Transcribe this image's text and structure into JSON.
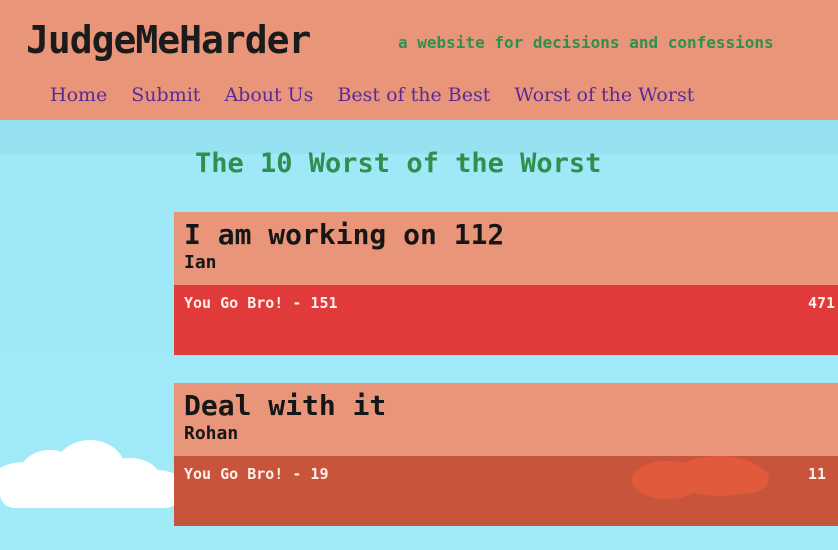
{
  "site": {
    "title": "JudgeMeHarder",
    "tagline": "a website for decisions and confessions"
  },
  "nav": {
    "items": [
      {
        "label": "Home"
      },
      {
        "label": "Submit"
      },
      {
        "label": "About Us"
      },
      {
        "label": "Best of the Best"
      },
      {
        "label": "Worst of the Worst"
      }
    ]
  },
  "main": {
    "page_title": "The 10 Worst of the Worst",
    "posts": [
      {
        "title": "I am working on 112",
        "author": "Ian",
        "vote_left": "You Go Bro! - 151",
        "vote_right": "471"
      },
      {
        "title": "Deal with it",
        "author": "Rohan",
        "vote_left": "You Go Bro! - 19",
        "vote_right": "11"
      }
    ]
  },
  "colors": {
    "header_bg": "#e8957a",
    "nav_link": "#5b2a9a",
    "accent_green": "#2f8f4e",
    "sky": "#a1eaf8",
    "bar_red_1": "#e03b3a",
    "bar_red_2": "#c8553b"
  }
}
